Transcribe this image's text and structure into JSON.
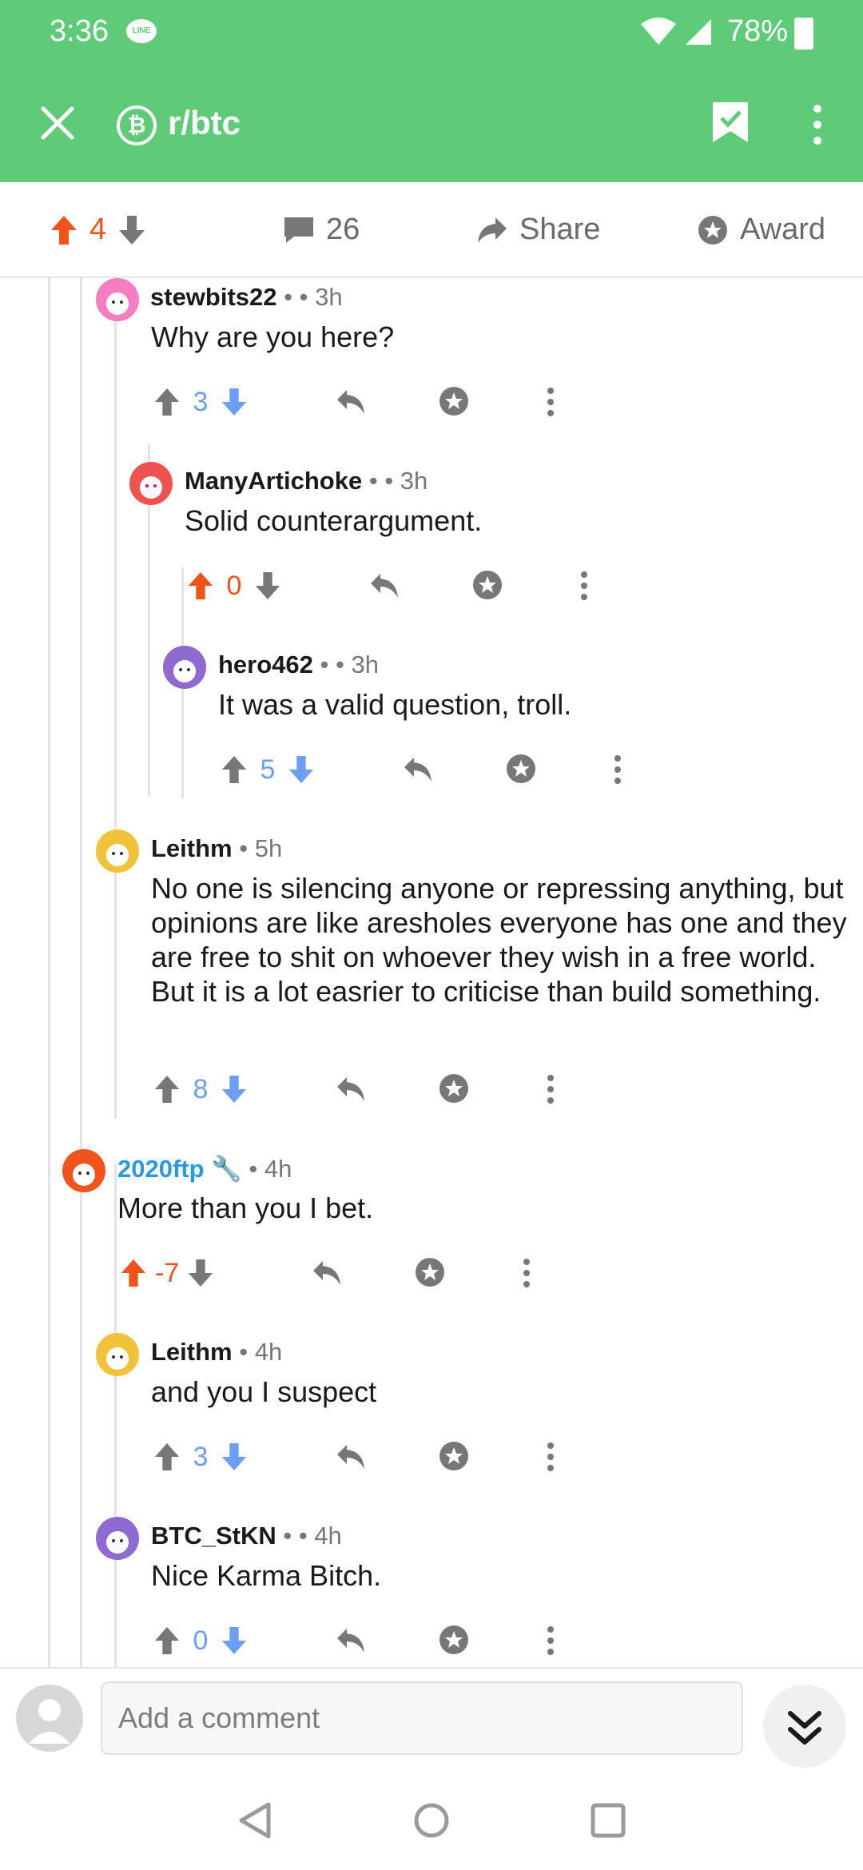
{
  "status_bar": {
    "time": "3:36",
    "notification_icon": "line-icon",
    "battery": "78%"
  },
  "toolbar": {
    "subreddit": "r/btc",
    "close_icon": "close-icon",
    "bookmark_icon": "bookmark-icon",
    "more_icon": "more-icon"
  },
  "post_actions": {
    "score": "4",
    "comments": "26",
    "share": "Share",
    "award": "Award"
  },
  "comments": [
    {
      "id": "c1",
      "user": "stewbits22",
      "sep": "•",
      "time": "• 3h",
      "text": "Why are you here?",
      "score": "3",
      "vote_state": "none"
    },
    {
      "id": "c2",
      "user": "ManyArtichoke",
      "sep": "•",
      "time": "• 3h",
      "text": "Solid counterargument.",
      "score": "0",
      "vote_state": "up"
    },
    {
      "id": "c3",
      "user": "hero462",
      "sep": "•",
      "time": "• 3h",
      "text": "It was a valid question, troll.",
      "score": "5",
      "vote_state": "none"
    },
    {
      "id": "c4",
      "user": "Leithm",
      "sep": "",
      "time": "• 5h",
      "text": "No one is silencing anyone or repressing anything, but opinions are like aresholes everyone has one and they are free to shit on whoever they wish in a free world.    But it is a lot easrier to criticise than build something.",
      "score": "8",
      "vote_state": "none"
    },
    {
      "id": "c5",
      "user": "2020ftp",
      "sep": "",
      "time": "• 4h",
      "text": "More than you I bet.",
      "score": "-7",
      "vote_state": "up",
      "is_mod_like": true
    },
    {
      "id": "c6",
      "user": "Leithm",
      "sep": "",
      "time": "• 4h",
      "text": "and you I suspect",
      "score": "3",
      "vote_state": "none"
    },
    {
      "id": "c7",
      "user": "BTC_StKN",
      "sep": "•",
      "time": "• 4h",
      "text": "Nice Karma Bitch.",
      "score": "0",
      "vote_state": "none"
    }
  ],
  "composer": {
    "placeholder": "Add a comment"
  },
  "colors": {
    "brand_green": "#5fcb78",
    "upvote_orange": "#f0531c",
    "downvote_blue": "#6c9ef8"
  }
}
